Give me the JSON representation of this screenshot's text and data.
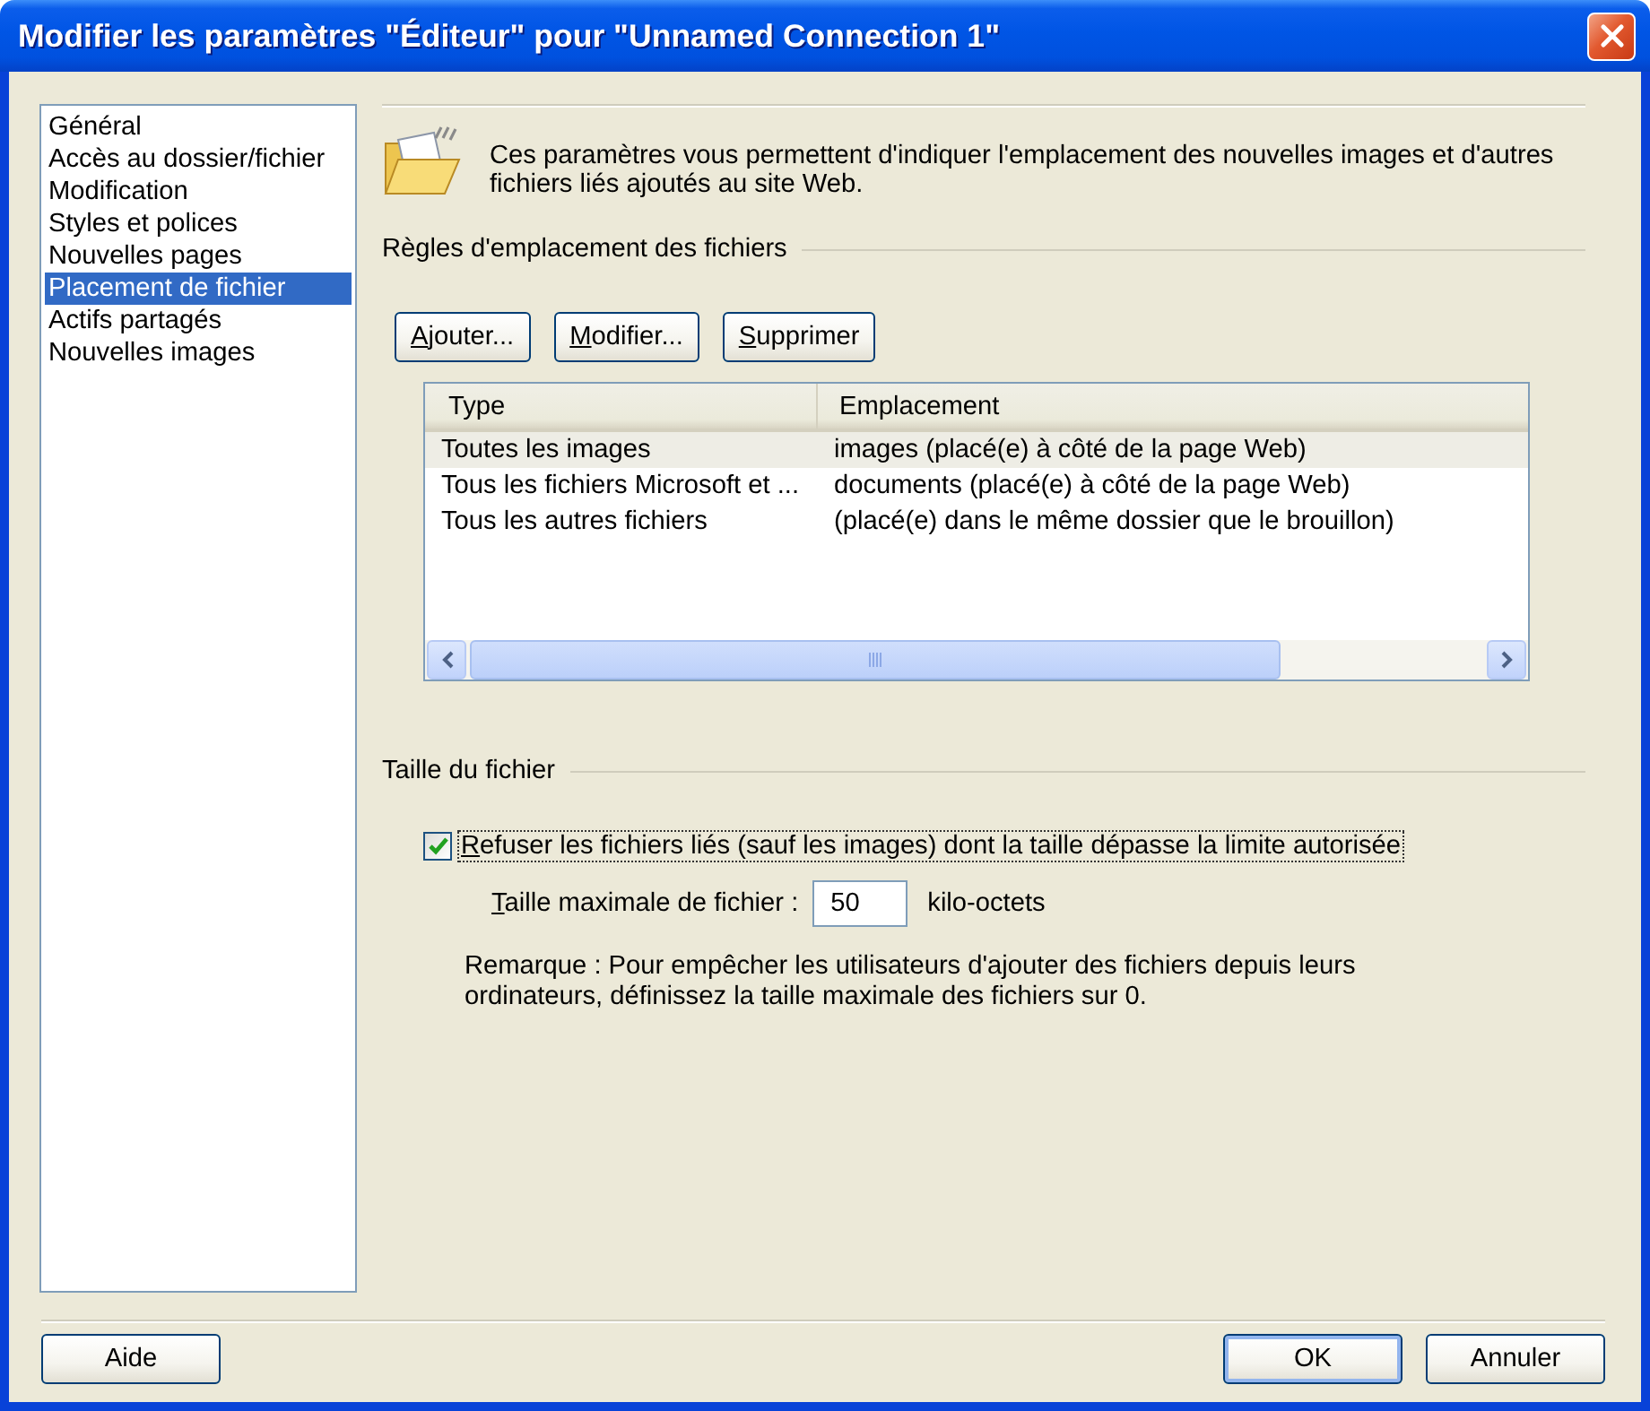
{
  "window": {
    "title": "Modifier les paramètres \"Éditeur\" pour \"Unnamed Connection 1\""
  },
  "sidebar": {
    "items": [
      {
        "label": "Général",
        "selected": false
      },
      {
        "label": "Accès au dossier/fichier",
        "selected": false
      },
      {
        "label": "Modification",
        "selected": false
      },
      {
        "label": "Styles et polices",
        "selected": false
      },
      {
        "label": "Nouvelles pages",
        "selected": false
      },
      {
        "label": "Placement de fichier",
        "selected": true
      },
      {
        "label": "Actifs partagés",
        "selected": false
      },
      {
        "label": "Nouvelles images",
        "selected": false
      }
    ]
  },
  "intro": {
    "description": "Ces paramètres vous permettent d'indiquer l'emplacement des nouvelles images et d'autres fichiers liés ajoutés au site Web."
  },
  "rules": {
    "title": "Règles d'emplacement des fichiers",
    "buttons": [
      {
        "label": "Ajouter...",
        "mnemonic": true
      },
      {
        "label": "Modifier...",
        "mnemonic": true
      },
      {
        "label": "Supprimer",
        "mnemonic": true
      }
    ],
    "table": {
      "columns": [
        "Type",
        "Emplacement"
      ],
      "rows": [
        {
          "cells": [
            "Toutes les images",
            "images (placé(e) à côté de la page Web)"
          ],
          "selected": true
        },
        {
          "cells": [
            "Tous les fichiers Microsoft et ...",
            "documents (placé(e) à côté de la page Web)"
          ],
          "selected": false
        },
        {
          "cells": [
            "Tous les autres fichiers",
            "(placé(e) dans le même dossier que le brouillon)"
          ],
          "selected": false
        }
      ]
    }
  },
  "file_size": {
    "title": "Taille du fichier",
    "checkbox": {
      "label": "Refuser les fichiers liés (sauf les images) dont la taille dépasse la limite autorisée",
      "mnemonic": true,
      "checked": true,
      "focused": true
    },
    "max_size": {
      "label": "Taille maximale de fichier :",
      "mnemonic": true,
      "value": "50",
      "unit": "kilo-octets"
    },
    "note": "Remarque : Pour empêcher les utilisateurs d'ajouter des fichiers depuis leurs ordinateurs, définissez la taille maximale des fichiers sur 0."
  },
  "footer": {
    "left_buttons": [
      {
        "label": "Aide",
        "default": false
      }
    ],
    "right_buttons": [
      {
        "label": "OK",
        "default": true
      },
      {
        "label": "Annuler",
        "default": false
      }
    ]
  }
}
